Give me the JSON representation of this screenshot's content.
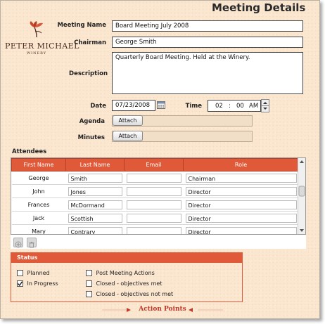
{
  "title": "Meeting Details",
  "logo": {
    "name": "PETER MICHAEL",
    "sub": "WINERY"
  },
  "form": {
    "meeting_name_label": "Meeting Name",
    "meeting_name": "Board Meeting July 2008",
    "chairman_label": "Chairman",
    "chairman": "George Smith",
    "description_label": "Description",
    "description": "Quarterly Board Meeting. Held at the Winery.",
    "date_label": "Date",
    "date": "07/23/2008",
    "time_label": "Time",
    "time_hour": "02",
    "time_minute": "00",
    "time_ampm": "AM",
    "agenda_label": "Agenda",
    "minutes_label": "Minutes",
    "attach_label": "Attach"
  },
  "attendees": {
    "label": "Attendees",
    "columns": [
      "First Name",
      "Last Name",
      "Email",
      "Role"
    ],
    "rows": [
      {
        "first": "George",
        "last": "Smith",
        "email": "",
        "role": "Chairman"
      },
      {
        "first": "John",
        "last": "Jones",
        "email": "",
        "role": "Director"
      },
      {
        "first": "Frances",
        "last": "McDormand",
        "email": "",
        "role": "Director"
      },
      {
        "first": "Jack",
        "last": "Scottish",
        "email": "",
        "role": "Director"
      },
      {
        "first": "Mary",
        "last": "Contrary",
        "email": "",
        "role": "Director"
      }
    ]
  },
  "status": {
    "label": "Status",
    "options": [
      {
        "label": "Planned",
        "checked": false
      },
      {
        "label": "In Progress",
        "checked": true
      },
      {
        "label": "Post Meeting Actions",
        "checked": false
      },
      {
        "label": "Closed - objectives met",
        "checked": false
      },
      {
        "label": "Closed - objectives not met",
        "checked": false
      }
    ]
  },
  "action_points": "Action Points",
  "colors": {
    "accent": "#e05a3a",
    "background": "#fbe6cf",
    "action_text": "#c0392b"
  }
}
